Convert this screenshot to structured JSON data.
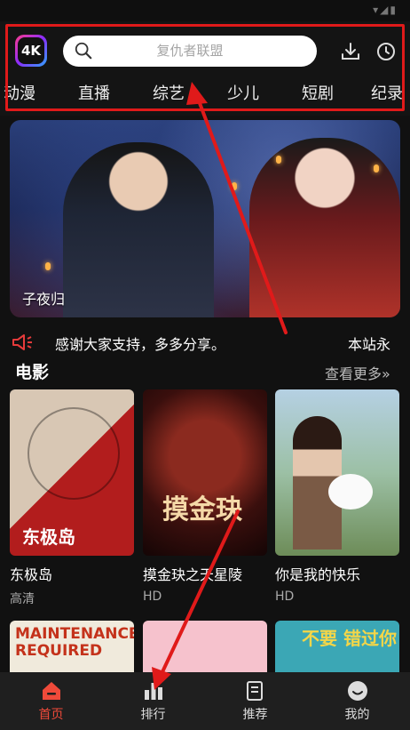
{
  "header": {
    "search_placeholder": "复仇者联盟",
    "categories": [
      "动漫",
      "直播",
      "综艺",
      "少儿",
      "短剧",
      "纪录"
    ]
  },
  "banner": {
    "title": "子夜归"
  },
  "announcement": {
    "text": "感谢大家支持，多多分享。",
    "text2": "本站永"
  },
  "section": {
    "title": "电影",
    "see_more": "查看更多",
    "movies": [
      {
        "title": "东极岛",
        "tag": "高清",
        "poster_text": "东极岛"
      },
      {
        "title": "摸金玦之天星陵",
        "tag": "HD",
        "poster_text": "摸金玦"
      },
      {
        "title": "你是我的快乐",
        "tag": "HD",
        "poster_text": ""
      }
    ],
    "row2": [
      "MAINTENANCE REQUIRED",
      "",
      "不要 错过你"
    ]
  },
  "bottom_nav": {
    "items": [
      {
        "label": "首页",
        "icon": "home-icon",
        "active": true
      },
      {
        "label": "排行",
        "icon": "ranking-icon",
        "active": false
      },
      {
        "label": "推荐",
        "icon": "recommend-icon",
        "active": false
      },
      {
        "label": "我的",
        "icon": "profile-icon",
        "active": false
      }
    ]
  },
  "colors": {
    "accent": "#ef4a3a",
    "highlight": "#e01a1a",
    "background": "#111111"
  }
}
